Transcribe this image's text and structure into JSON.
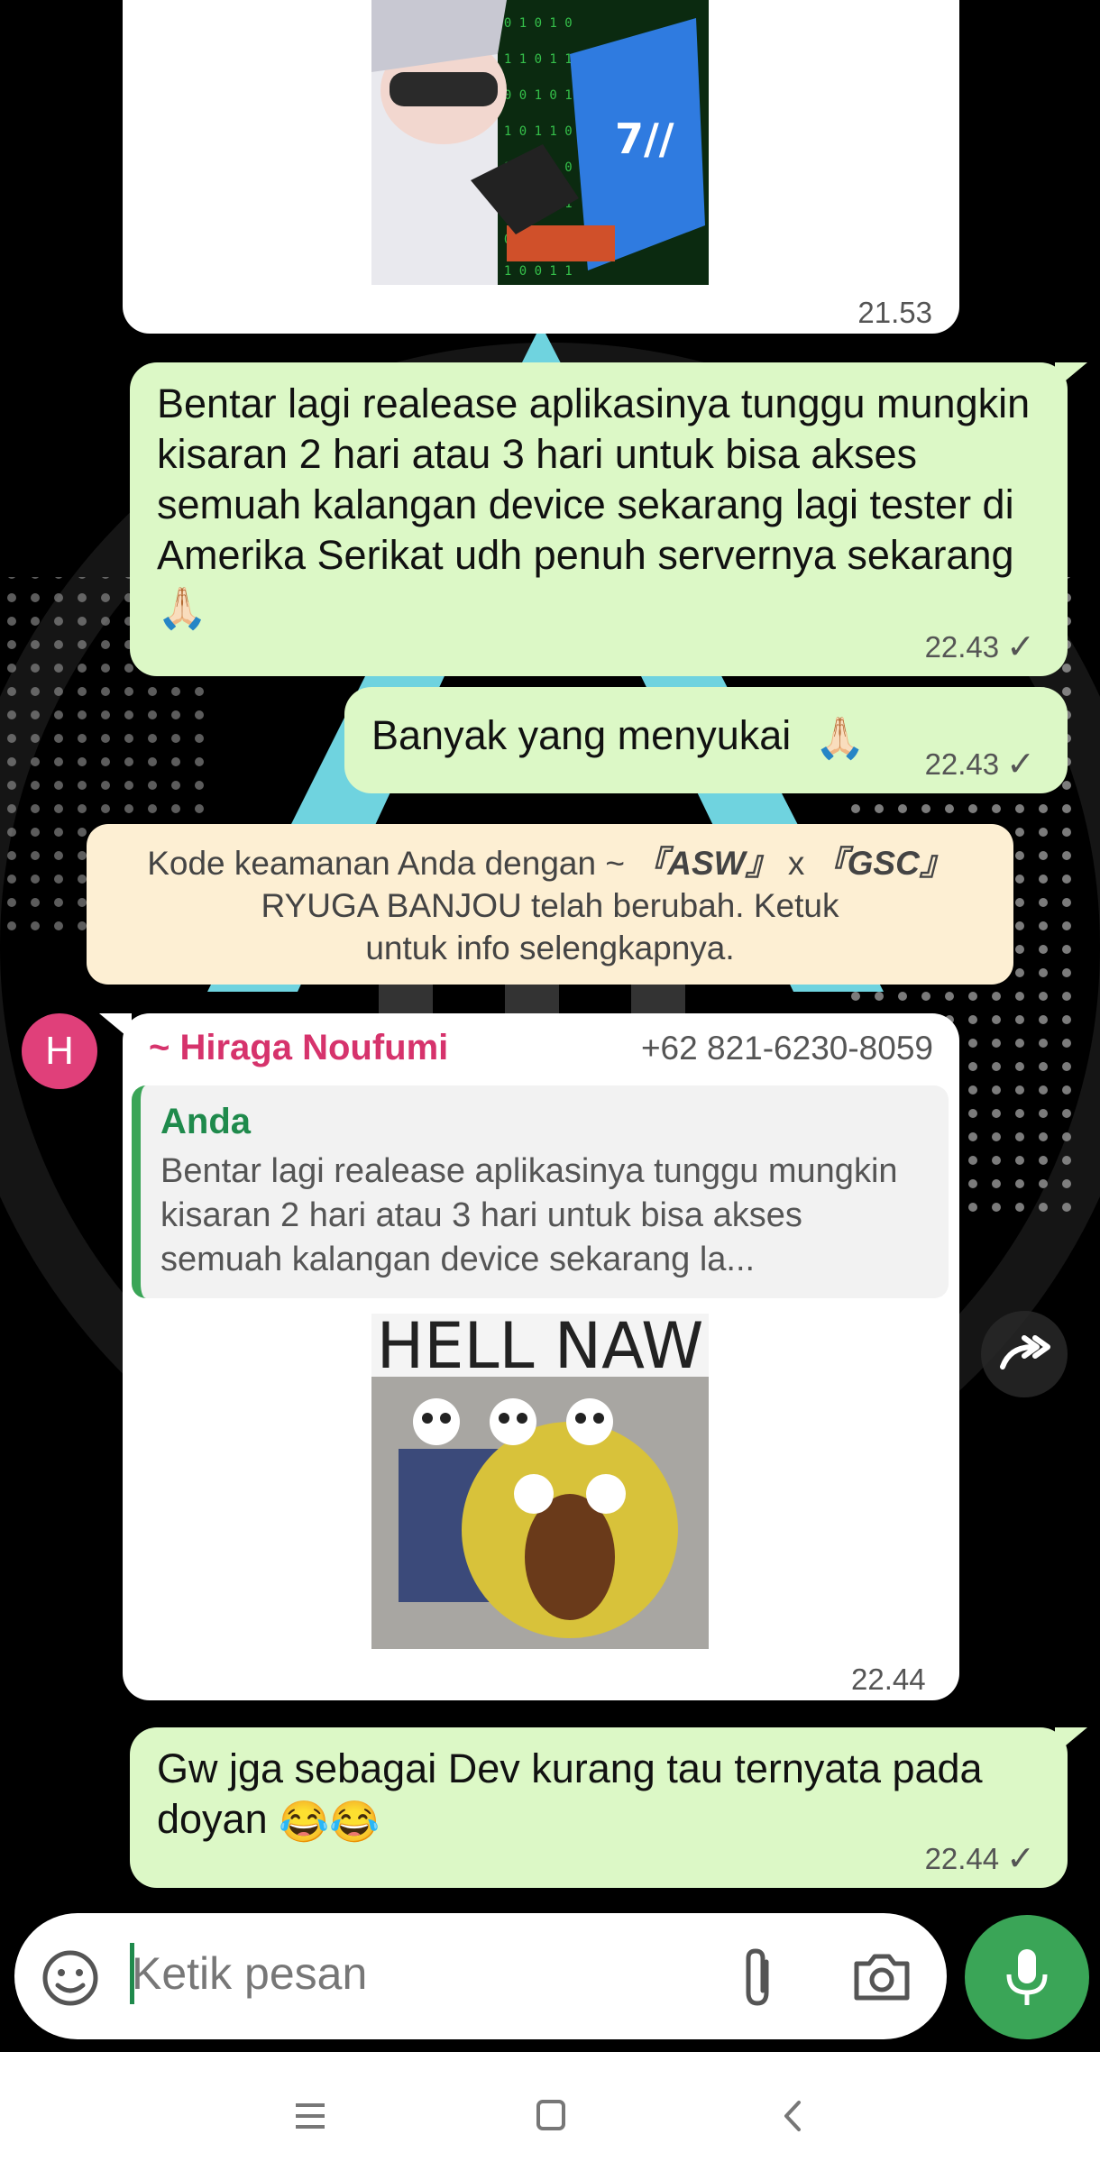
{
  "messages": [
    {
      "time": "21.53"
    },
    {
      "text": "Bentar lagi realease aplikasinya tunggu mungkin kisaran 2 hari atau 3 hari untuk bisa akses semuah kalangan device sekarang lagi tester di Amerika Serikat udh penuh servernya sekarang",
      "emoji": "🙏🏻",
      "time": "22.43"
    },
    {
      "text": "Banyak yang menyukai",
      "emoji": "🙏🏻",
      "time": "22.43"
    },
    {
      "sender": "~ Hiraga Noufumi",
      "phone": "+62 821-6230-8059",
      "avatar_letter": "H",
      "quote_author": "Anda",
      "quote_text": "Bentar lagi realease aplikasinya tunggu mungkin kisaran 2 hari atau 3 hari untuk bisa akses semuah kalangan device sekarang la...",
      "image_caption": "HELL NAW",
      "time": "22.44"
    },
    {
      "text": "Gw jga sebagai Dev kurang tau ternyata pada doyan",
      "emoji": "😂😂",
      "time": "22.44"
    }
  ],
  "security_notice": {
    "prefix": "Kode keamanan Anda dengan ~ ",
    "name_a": "『ASW』",
    "sep": " x ",
    "name_b": "『GSC』",
    "suffix": "RYUGA BANJOU telah berubah. Ketuk untuk info selengkapnya."
  },
  "input": {
    "placeholder": "Ketik pesan"
  },
  "icons": [
    "sticker-icon",
    "attach-icon",
    "camera-icon",
    "mic-icon",
    "forward-icon",
    "menu-nav-icon",
    "home-nav-icon",
    "back-nav-icon"
  ],
  "colors": {
    "outgoing": "#dcf8c6",
    "incoming": "#ffffff",
    "accent": "#3aa557",
    "sender": "#d6336c"
  }
}
